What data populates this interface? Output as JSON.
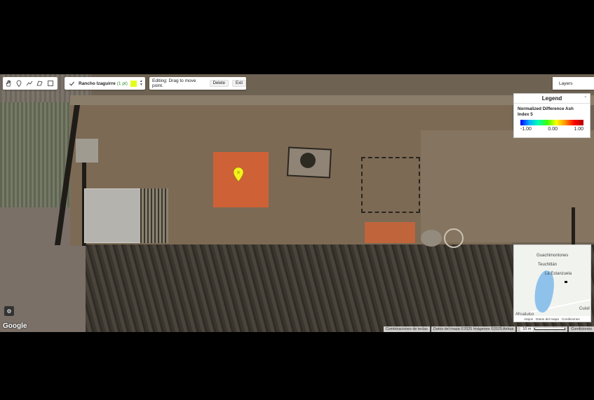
{
  "toolbar": {
    "tools": [
      {
        "icon": "hand-icon"
      },
      {
        "icon": "point-marker-icon"
      },
      {
        "icon": "polyline-icon"
      },
      {
        "icon": "polygon-icon"
      },
      {
        "icon": "rectangle-icon"
      }
    ]
  },
  "geometry_layer": {
    "name": "Rancho Izaguirre",
    "count": "(1 pt)",
    "color": "#e2ff1b"
  },
  "editing": {
    "message": "Editing: Drag to move point.",
    "delete_label": "Delete",
    "exit_label": "Exit"
  },
  "layers_button": {
    "label": "Layers"
  },
  "legend": {
    "header": "Legend",
    "collapse": "-",
    "title": "Normalized Difference Ash Index 5",
    "min": "-1.00",
    "mid": "0.00",
    "max": "1.00"
  },
  "minimap": {
    "labels": [
      "Guachimontones",
      "Teuchitlán",
      "La Estanzuela",
      "Cuisil",
      "Ahualulco"
    ],
    "footer": [
      "Atajos",
      "Datos del mapa",
      "Condiciones"
    ]
  },
  "attribution": {
    "logo": "Google",
    "shortcuts": "Combinaciones de teclas",
    "map_data": "Datos del mapa ©2025 Imágenes ©2025 Airbus",
    "scale": "10 m",
    "terms": "Condiciones"
  }
}
